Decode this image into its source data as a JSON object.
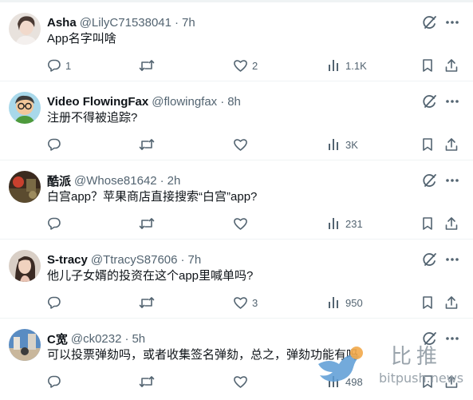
{
  "tweets": [
    {
      "name": "Asha",
      "handle": "@LilyC71538041",
      "time": "7h",
      "text": "App名字叫啥",
      "replies": "1",
      "retweets": "",
      "likes": "2",
      "views": "1.1K"
    },
    {
      "name": "Video FlowingFax",
      "handle": "@flowingfax",
      "time": "8h",
      "text": "注册不得被追踪?",
      "replies": "",
      "retweets": "",
      "likes": "",
      "views": "3K"
    },
    {
      "name": "酷派",
      "handle": "@Whose81642",
      "time": "2h",
      "text": "白宫app？苹果商店直接搜索“白宫”app?",
      "replies": "",
      "retweets": "",
      "likes": "",
      "views": "231"
    },
    {
      "name": "S-tracy",
      "handle": "@TtracyS87606",
      "time": "7h",
      "text": "他儿子女婿的投资在这个app里喊单吗?",
      "replies": "",
      "retweets": "",
      "likes": "3",
      "views": "950"
    },
    {
      "name": "C宽",
      "handle": "@ck0232",
      "time": "5h",
      "text": "可以投票弹劾吗，或者收集签名弹劾，总之，弹劾功能有吗",
      "replies": "",
      "retweets": "",
      "likes": "",
      "views": "498"
    }
  ],
  "separator": "·",
  "watermark": {
    "cn": "比推",
    "en": "bitpush.news"
  },
  "icons": [
    "grok-icon",
    "more-icon",
    "reply-icon",
    "retweet-icon",
    "like-icon",
    "views-icon",
    "bookmark-icon",
    "share-icon"
  ],
  "colors": {
    "text": "#0f1419",
    "secondary": "#536471",
    "divider": "#eff3f4"
  }
}
